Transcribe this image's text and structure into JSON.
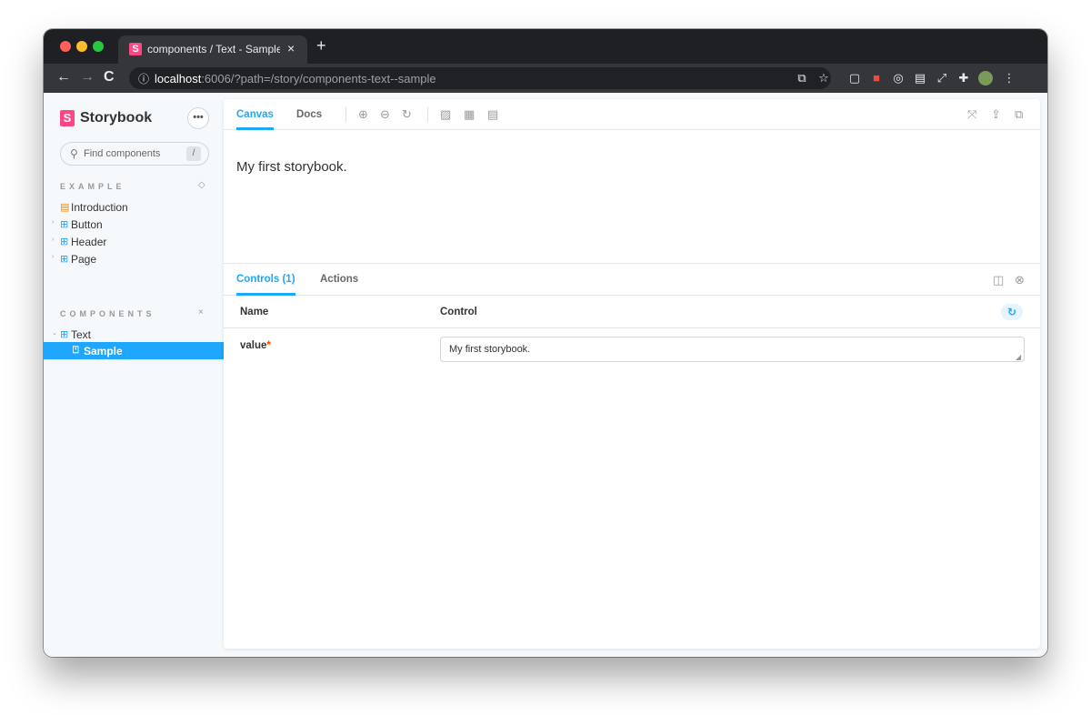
{
  "browser": {
    "tab_title": "components / Text - Sample - Storybook",
    "tab_close": "×",
    "new_tab": "+",
    "favicon_letter": "S",
    "back": "←",
    "forward": "→",
    "reload": "C",
    "url_host": "localhost",
    "url_rest": ":6006/?path=/story/components-text--sample",
    "extension_icons": [
      "translate-icon",
      "star-icon",
      "extension-icon-1",
      "extension-icon-2",
      "extension-icon-3",
      "extension-icon-4",
      "extension-icon-5",
      "puzzle-icon",
      "profile-icon",
      "more-icon"
    ]
  },
  "sidebar": {
    "brand_letter": "S",
    "brand_name": "Storybook",
    "menu_label": "•••",
    "search_placeholder": "Find components",
    "search_shortcut": "/",
    "sections": [
      {
        "title": "EXAMPLE",
        "items": [
          {
            "label": "Introduction",
            "type": "doc"
          },
          {
            "label": "Button",
            "type": "component"
          },
          {
            "label": "Header",
            "type": "component"
          },
          {
            "label": "Page",
            "type": "component"
          }
        ]
      },
      {
        "title": "COMPONENTS",
        "items": [
          {
            "label": "Text",
            "type": "component",
            "expanded": true
          },
          {
            "label": "Sample",
            "type": "story",
            "selected": true
          }
        ]
      }
    ]
  },
  "main": {
    "tabs": [
      {
        "label": "Canvas",
        "active": true
      },
      {
        "label": "Docs",
        "active": false
      }
    ],
    "tools": [
      "zoom-in-icon",
      "zoom-out-icon",
      "zoom-reset-icon",
      "background-icon",
      "grid-icon",
      "outline-icon"
    ],
    "right_tools": [
      "fullscreen-icon",
      "share-icon",
      "copy-link-icon"
    ],
    "preview_text": "My first storybook."
  },
  "addons": {
    "tabs": [
      {
        "label": "Controls (1)",
        "active": true
      },
      {
        "label": "Actions",
        "active": false
      }
    ],
    "columns": {
      "name": "Name",
      "control": "Control"
    },
    "rows": [
      {
        "name": "value",
        "required_mark": "*",
        "value": "My first storybook."
      }
    ]
  },
  "colors": {
    "accent": "#1ea7fd",
    "brand": "#ff4785",
    "required": "#ff4400"
  }
}
